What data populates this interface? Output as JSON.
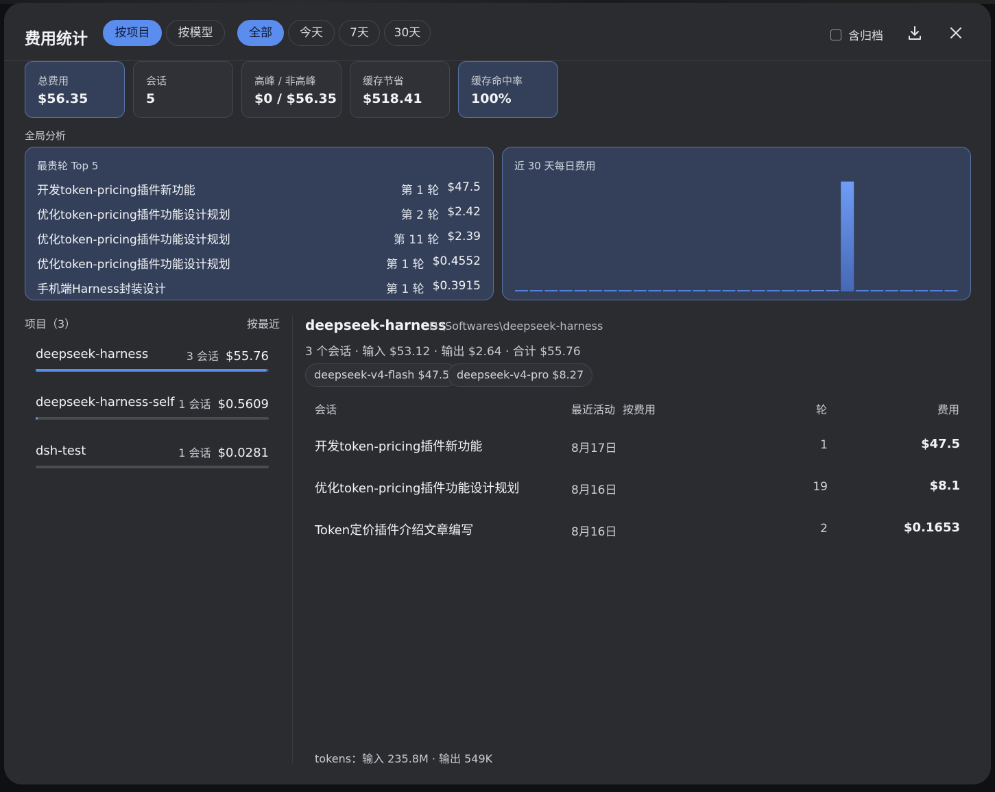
{
  "header": {
    "title": "费用统计",
    "group_tabs": [
      "按项目",
      "按模型"
    ],
    "active_group": 0,
    "range_tabs": [
      "全部",
      "今天",
      "7天",
      "30天"
    ],
    "active_range": 0,
    "archive_label": "含归档"
  },
  "stats": [
    {
      "label": "总费用",
      "value": "$56.35",
      "highlight": true
    },
    {
      "label": "会话",
      "value": "5",
      "highlight": false
    },
    {
      "label": "高峰 / 非高峰",
      "value": "$0 / $56.35",
      "highlight": false
    },
    {
      "label": "缓存节省",
      "value": "$518.41",
      "highlight": false
    },
    {
      "label": "缓存命中率",
      "value": "100%",
      "highlight": true
    }
  ],
  "analysis": {
    "section_label": "全局分析",
    "top5": {
      "title": "最贵轮 Top 5",
      "rows": [
        {
          "name": "开发token-pricing插件新功能",
          "round": "第 1 轮",
          "cost": "$47.5"
        },
        {
          "name": "优化token-pricing插件功能设计规划",
          "round": "第 2 轮",
          "cost": "$2.42"
        },
        {
          "name": "优化token-pricing插件功能设计规划",
          "round": "第 11 轮",
          "cost": "$2.39"
        },
        {
          "name": "优化token-pricing插件功能设计规划",
          "round": "第 1 轮",
          "cost": "$0.4552"
        },
        {
          "name": "手机端Harness封装设计",
          "round": "第 1 轮",
          "cost": "$0.3915"
        }
      ]
    },
    "daily": {
      "title": "近 30 天每日费用"
    }
  },
  "chart_data": {
    "type": "bar",
    "title": "近 30 天每日费用",
    "values": [
      0,
      0,
      0,
      0,
      0,
      0,
      0,
      0,
      0,
      0,
      0,
      0,
      0,
      0,
      0,
      0,
      0,
      0,
      0,
      0,
      0.42,
      0.39,
      47.5,
      0,
      0,
      0,
      0,
      0,
      0,
      0
    ],
    "ylim": [
      0,
      48
    ],
    "grid": false,
    "colors": {
      "bar": "#5b8def"
    }
  },
  "projects": {
    "header": "项目（3）",
    "sort_label": "按最近",
    "items": [
      {
        "name": "deepseek-harness",
        "count": "3 会话",
        "cost": "$55.76",
        "share": 0.99
      },
      {
        "name": "deepseek-harness-self",
        "count": "1 会话",
        "cost": "$0.5609",
        "share": 0.01
      },
      {
        "name": "dsh-test",
        "count": "1 会话",
        "cost": "$0.0281",
        "share": 0.0
      }
    ]
  },
  "detail": {
    "title": "deepseek-harness",
    "path": "D:\\Softwares\\deepseek-harness",
    "summary": "3 个会话 · 输入 $53.12 · 输出 $2.64 · 合计 $55.76",
    "chips": [
      "deepseek-v4-flash $47.5",
      "deepseek-v4-pro $8.27"
    ],
    "columns": {
      "session": "会话",
      "recent": "最近活动",
      "by_cost": "按费用",
      "rounds": "轮",
      "cost": "费用"
    },
    "rows": [
      {
        "session": "开发token-pricing插件新功能",
        "date": "8月17日",
        "rounds": "1",
        "cost": "$47.5"
      },
      {
        "session": "优化token-pricing插件功能设计规划",
        "date": "8月16日",
        "rounds": "19",
        "cost": "$8.1"
      },
      {
        "session": "Token定价插件介绍文章编写",
        "date": "8月16日",
        "rounds": "2",
        "cost": "$0.1653"
      }
    ],
    "tokens": "tokens：输入 235.8M · 输出 549K"
  },
  "colors": {
    "accent": "#5b8def",
    "panel": "#34405a",
    "background": "#2b2c30"
  }
}
